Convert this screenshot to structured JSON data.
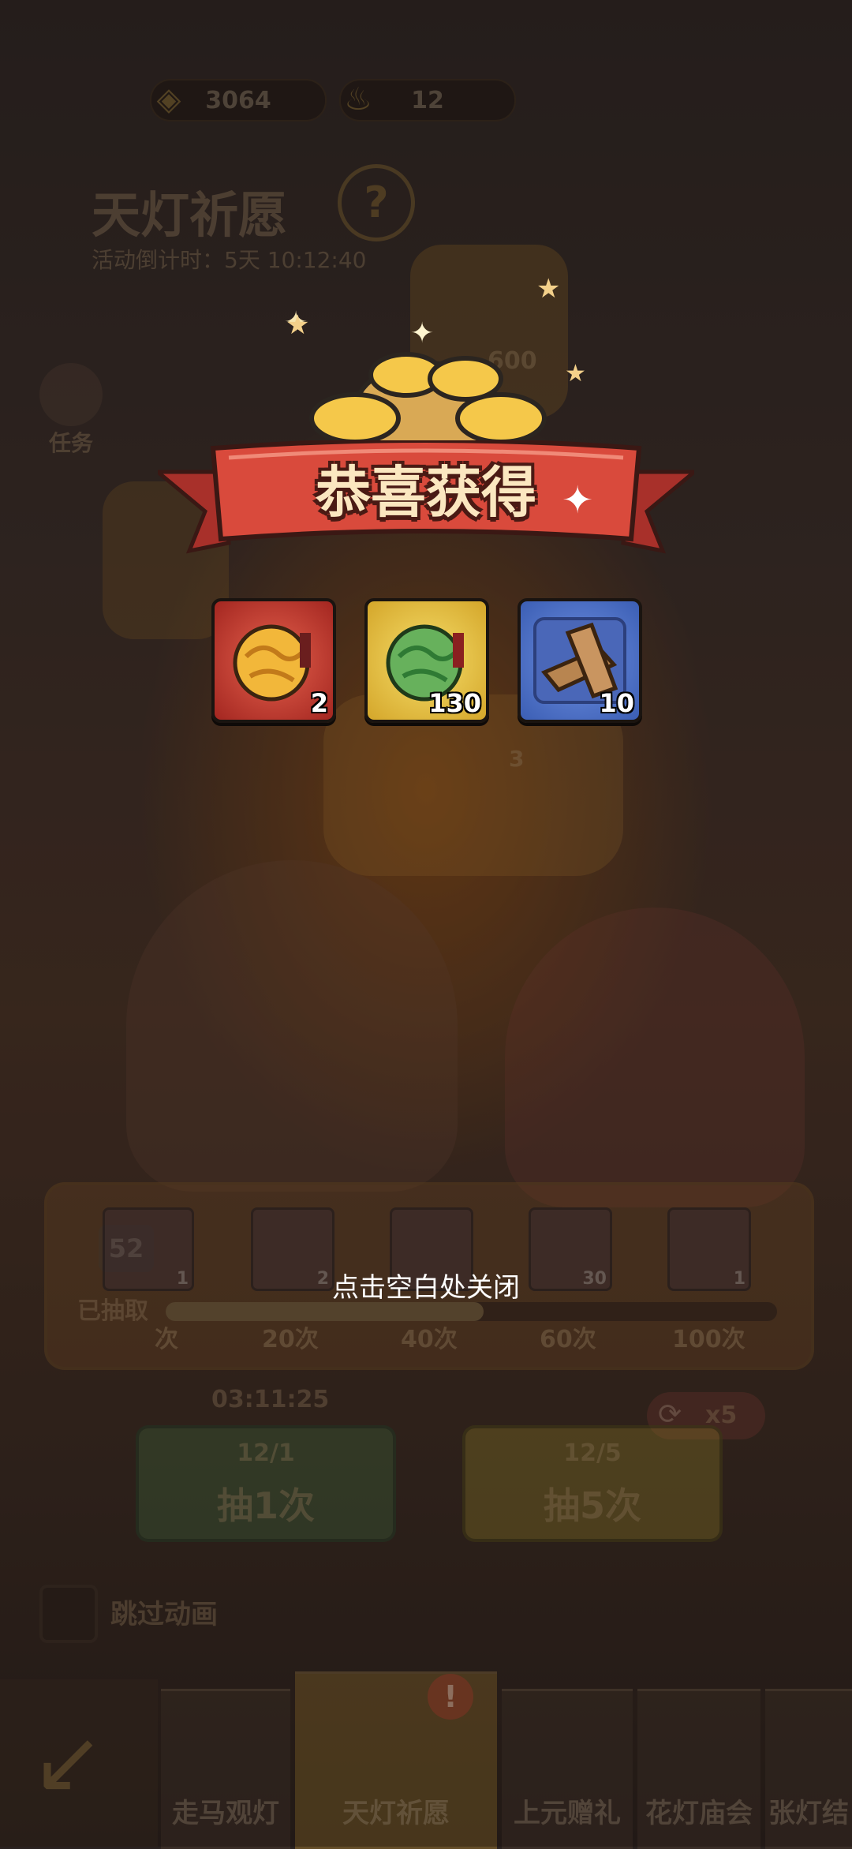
{
  "top_bar": {
    "gold_value": "3064",
    "lamp_value": "12"
  },
  "event": {
    "title": "天灯祈愿",
    "countdown": "活动倒计时：5天 10:12:40",
    "task_label": "任务",
    "lantern_value": "600",
    "lantern_value_2": "3"
  },
  "popup": {
    "title": "恭喜获得",
    "rewards": [
      {
        "name": "gold-dragon-orb",
        "count": "2",
        "frame_color": "#c8322c"
      },
      {
        "name": "jade-dragon-orb",
        "count": "130",
        "frame_color": "#e9c23a"
      },
      {
        "name": "wood-planks",
        "count": "10",
        "frame_color": "#4a72c8"
      }
    ],
    "close_hint": "点击空白处关闭"
  },
  "progress": {
    "drawn_count": "52",
    "drawn_label": "已抽取",
    "milestones": [
      "次",
      "20次",
      "40次",
      "60次",
      "100次"
    ],
    "slot_counts": [
      "1",
      "2",
      "",
      "30",
      "1"
    ],
    "fill_fraction": 0.52
  },
  "draw": {
    "timer": "03:11:25",
    "multiplier": "x5",
    "one": {
      "cost": "12/1",
      "label": "抽1次"
    },
    "five": {
      "cost": "12/5",
      "label": "抽5次"
    },
    "skip_label": "跳过动画"
  },
  "bottom_nav": {
    "tabs": [
      "走马观灯",
      "天灯祈愿",
      "上元赠礼",
      "花灯庙会",
      "张灯结"
    ]
  },
  "colors": {
    "ribbon_red": "#d94a3c",
    "title_cream": "#fbe7c0",
    "btn_green": "#4c7c4a",
    "btn_yellow": "#c8b234"
  }
}
